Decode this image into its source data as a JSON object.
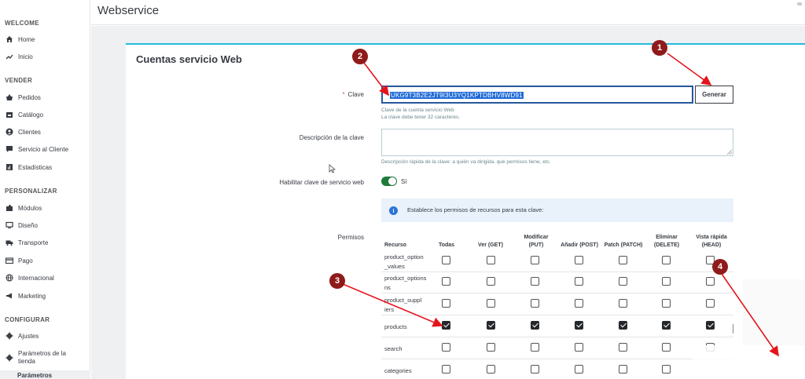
{
  "sidebar": {
    "sections": [
      "WELCOME",
      "VENDER",
      "PERSONALIZAR",
      "CONFIGURAR"
    ],
    "items": [
      {
        "label": "Home",
        "icon": "home-icon"
      },
      {
        "label": "Inicio",
        "icon": "trending-up-icon"
      },
      {
        "label": "Pedidos",
        "icon": "basket-icon"
      },
      {
        "label": "Catálogo",
        "icon": "store-icon"
      },
      {
        "label": "Clientes",
        "icon": "user-circle-icon"
      },
      {
        "label": "Servicio al Cliente",
        "icon": "chat-icon"
      },
      {
        "label": "Estadísticas",
        "icon": "bar-chart-icon"
      },
      {
        "label": "Módulos",
        "icon": "puzzle-icon"
      },
      {
        "label": "Diseño",
        "icon": "monitor-icon"
      },
      {
        "label": "Transporte",
        "icon": "truck-icon"
      },
      {
        "label": "Pago",
        "icon": "credit-card-icon"
      },
      {
        "label": "Internacional",
        "icon": "globe-icon"
      },
      {
        "label": "Marketing",
        "icon": "megaphone-icon"
      },
      {
        "label": "Ajustes",
        "icon": "gear-icon"
      },
      {
        "label": "Parámetros de la tienda",
        "icon": "gear-icon"
      }
    ],
    "bottom_label": "Parámetros"
  },
  "header": {
    "title": "Webservice"
  },
  "card": {
    "title": "Cuentas servicio Web"
  },
  "form": {
    "key_label": "Clave",
    "key_value": "UKG9T3B2E2JT9I3U3YQ1KPTDBHV8WD91",
    "generate_label": "Generar",
    "key_help_1": "Clave de la cuenta servicio Web",
    "key_help_2": "La clave debe tener 32 caracteres.",
    "desc_label": "Descripción de la clave",
    "desc_help": "Descripción rápida de la clave: a quién va dirigida, qué permisos tiene, etc.",
    "enable_label": "Habilitar clave de servicio web",
    "enable_value": "Sí",
    "enabled": true,
    "alert_text": "Establece los permisos de recursos para esta clave:",
    "perms_label": "Permisos"
  },
  "permissions": {
    "headers": {
      "resource": "Recurso",
      "all": "Todas",
      "get": "Ver (GET)",
      "put_1": "Modificar",
      "put_2": "(PUT)",
      "post": "Añadir (POST)",
      "patch": "Patch (PATCH)",
      "delete_1": "Eliminar",
      "delete_2": "(DELETE)",
      "head_1": "Vista rápida",
      "head_2": "(HEAD)"
    },
    "rows": [
      {
        "name_1": "product_option",
        "name_2": "_values",
        "checked": false
      },
      {
        "name_1": "product_options",
        "name_2": "ns",
        "checked": false
      },
      {
        "name_1": "product_suppl",
        "name_2": "iers",
        "checked": false
      },
      {
        "name_1": "products",
        "name_2": "",
        "checked": true
      },
      {
        "name_1": "search",
        "name_2": "",
        "checked": false
      },
      {
        "name_1": "categories",
        "name_2": "",
        "checked": false
      }
    ]
  },
  "annotations": {
    "badge_1": "1",
    "badge_2": "2",
    "badge_3": "3",
    "badge_4": "4",
    "arrow_color": "#e4141b"
  },
  "colors": {
    "accent": "#25b9d7",
    "toggle": "#1f7a3a",
    "badge": "#8f1a1a"
  }
}
